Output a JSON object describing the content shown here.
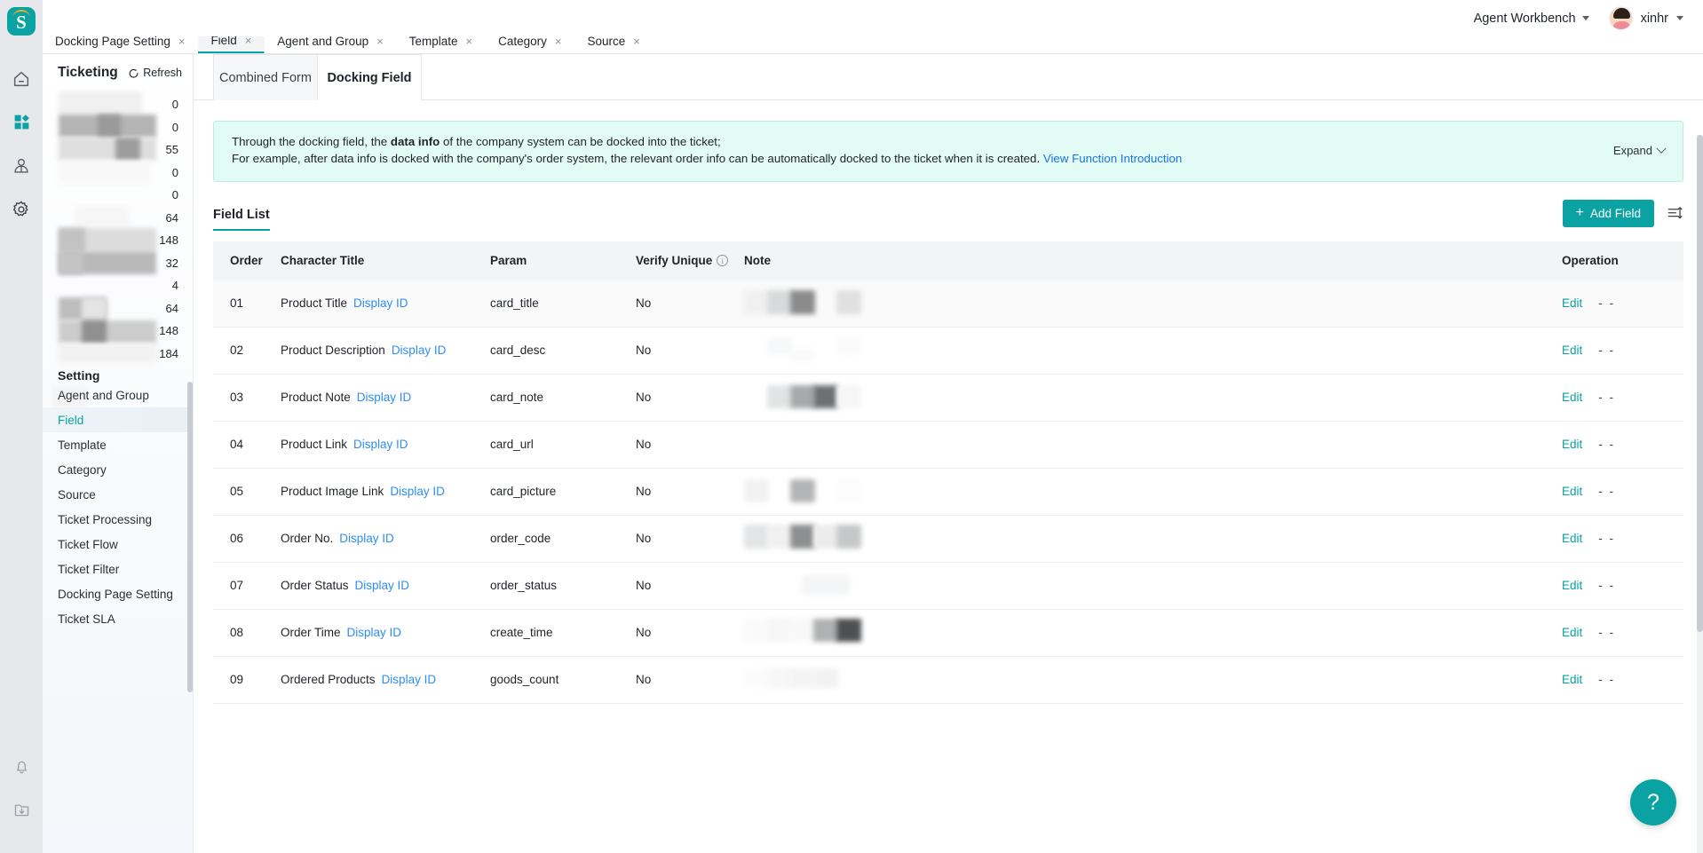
{
  "topbar": {
    "workbench_label": "Agent Workbench",
    "user_name": "xinhr"
  },
  "rail": {
    "icons": [
      "home-icon",
      "apps-icon",
      "agent-icon",
      "gear-icon",
      "bell-icon",
      "download-folder-icon"
    ],
    "logo_letter": "S"
  },
  "browser_tabs": [
    {
      "label": "Docking Page Setting",
      "close": "×",
      "active": false
    },
    {
      "label": "Field",
      "close": "×",
      "active": true
    },
    {
      "label": "Agent and Group",
      "close": "×",
      "active": false
    },
    {
      "label": "Template",
      "close": "×",
      "active": false
    },
    {
      "label": "Category",
      "close": "×",
      "active": false
    },
    {
      "label": "Source",
      "close": "×",
      "active": false
    }
  ],
  "sidebar": {
    "title": "Ticketing",
    "refresh_label": "Refresh",
    "redacted_counts": [
      "0",
      "0",
      "55",
      "0",
      "0",
      "64",
      "148",
      "32",
      "4",
      "64",
      "148",
      "184"
    ],
    "section_label": "Setting",
    "items": [
      {
        "label": "Agent and Group",
        "active": false
      },
      {
        "label": "Field",
        "active": true
      },
      {
        "label": "Template",
        "active": false
      },
      {
        "label": "Category",
        "active": false
      },
      {
        "label": "Source",
        "active": false
      },
      {
        "label": "Ticket Processing",
        "active": false
      },
      {
        "label": "Ticket Flow",
        "active": false
      },
      {
        "label": "Ticket Filter",
        "active": false
      },
      {
        "label": "Docking Page Setting",
        "active": false
      },
      {
        "label": "Ticket SLA",
        "active": false
      }
    ]
  },
  "content": {
    "card_tabs": [
      {
        "label": "Combined Form",
        "active": false
      },
      {
        "label": "Docking Field",
        "active": true
      }
    ],
    "banner": {
      "line1_a": "Through the docking field, the ",
      "line1_b": "data info",
      "line1_c": " of the company system can be docked into the ticket;",
      "line2": "For example, after data info is docked with the company's order system, the relevant order info can be automatically docked to the ticket when it is created. ",
      "link": "View Function Introduction",
      "expand_label": "Expand"
    },
    "list_title": "Field List",
    "add_button": "Add Field",
    "add_button_plus": "+",
    "columns": [
      "Order",
      "Character Title",
      "Param",
      "Verify Unique",
      "Note",
      "Operation"
    ],
    "rows": [
      {
        "order": "01",
        "title": "Product Title",
        "display_id": "Display ID",
        "param": "card_title",
        "verify": "No",
        "edit": "Edit",
        "more": "- -"
      },
      {
        "order": "02",
        "title": "Product Description",
        "display_id": "Display ID",
        "param": "card_desc",
        "verify": "No",
        "edit": "Edit",
        "more": "- -"
      },
      {
        "order": "03",
        "title": "Product Note",
        "display_id": "Display ID",
        "param": "card_note",
        "verify": "No",
        "edit": "Edit",
        "more": "- -"
      },
      {
        "order": "04",
        "title": "Product Link",
        "display_id": "Display ID",
        "param": "card_url",
        "verify": "No",
        "edit": "Edit",
        "more": "- -"
      },
      {
        "order": "05",
        "title": "Product Image Link",
        "display_id": "Display ID",
        "param": "card_picture",
        "verify": "No",
        "edit": "Edit",
        "more": "- -"
      },
      {
        "order": "06",
        "title": "Order No.",
        "display_id": "Display ID",
        "param": "order_code",
        "verify": "No",
        "edit": "Edit",
        "more": "- -"
      },
      {
        "order": "07",
        "title": "Order Status",
        "display_id": "Display ID",
        "param": "order_status",
        "verify": "No",
        "edit": "Edit",
        "more": "- -"
      },
      {
        "order": "08",
        "title": "Order Time",
        "display_id": "Display ID",
        "param": "create_time",
        "verify": "No",
        "edit": "Edit",
        "more": "- -"
      },
      {
        "order": "09",
        "title": "Ordered Products",
        "display_id": "Display ID",
        "param": "goods_count",
        "verify": "No",
        "edit": "Edit",
        "more": "- -"
      }
    ],
    "help_icon": "?"
  },
  "colors": {
    "accent": "#0aa2a2",
    "link": "#2f8ef4",
    "banner_bg": "#e3fbf5",
    "banner_link": "#1a73e8"
  }
}
